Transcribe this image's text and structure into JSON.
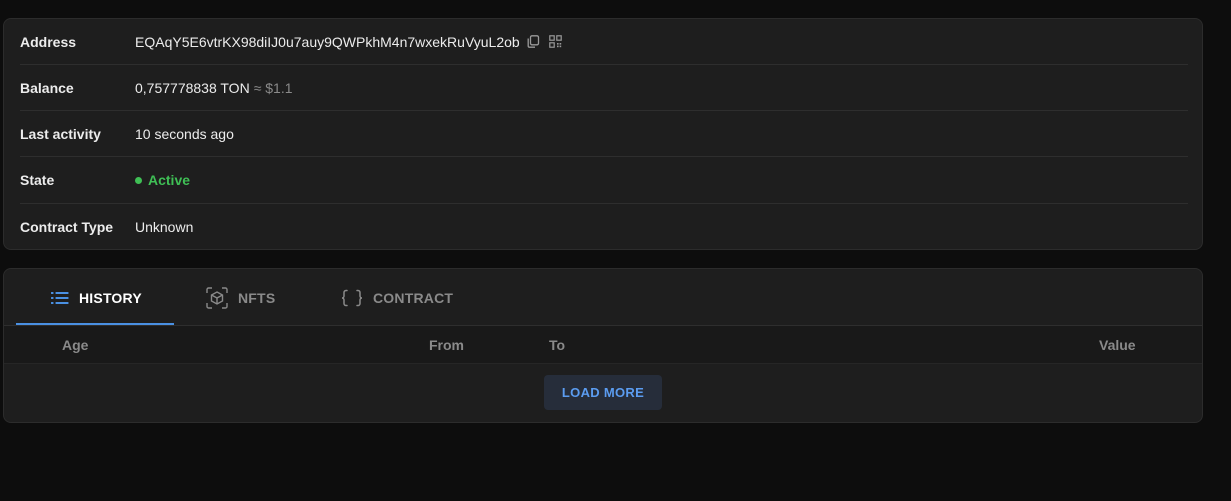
{
  "account": {
    "rows": [
      {
        "label": "Address",
        "value": "EQAqY5E6vtrKX98diIJ0u7auy9QWPkhM4n7wxekRuVyuL2ob"
      },
      {
        "label": "Balance",
        "value": "0,757778838 TON",
        "secondary": "≈ $1.1"
      },
      {
        "label": "Last activity",
        "value": "10 seconds ago"
      },
      {
        "label": "State",
        "value": "Active"
      },
      {
        "label": "Contract Type",
        "value": "Unknown"
      }
    ],
    "icons": {
      "copy": "copy-icon",
      "qr": "qr-code-icon"
    },
    "colors": {
      "state_active": "#3fbf55"
    }
  },
  "tabs": [
    {
      "label": "HISTORY",
      "icon": "list-icon",
      "active": true
    },
    {
      "label": "NFTS",
      "icon": "cube-icon",
      "active": false
    },
    {
      "label": "CONTRACT",
      "icon": "braces-icon",
      "active": false
    }
  ],
  "table": {
    "columns": [
      "Age",
      "From",
      "To",
      "Value"
    ]
  },
  "load_more_label": "LOAD MORE",
  "colors": {
    "accent": "#4a90e2",
    "background": "#0d0d0d",
    "card": "#1e1e1e"
  }
}
